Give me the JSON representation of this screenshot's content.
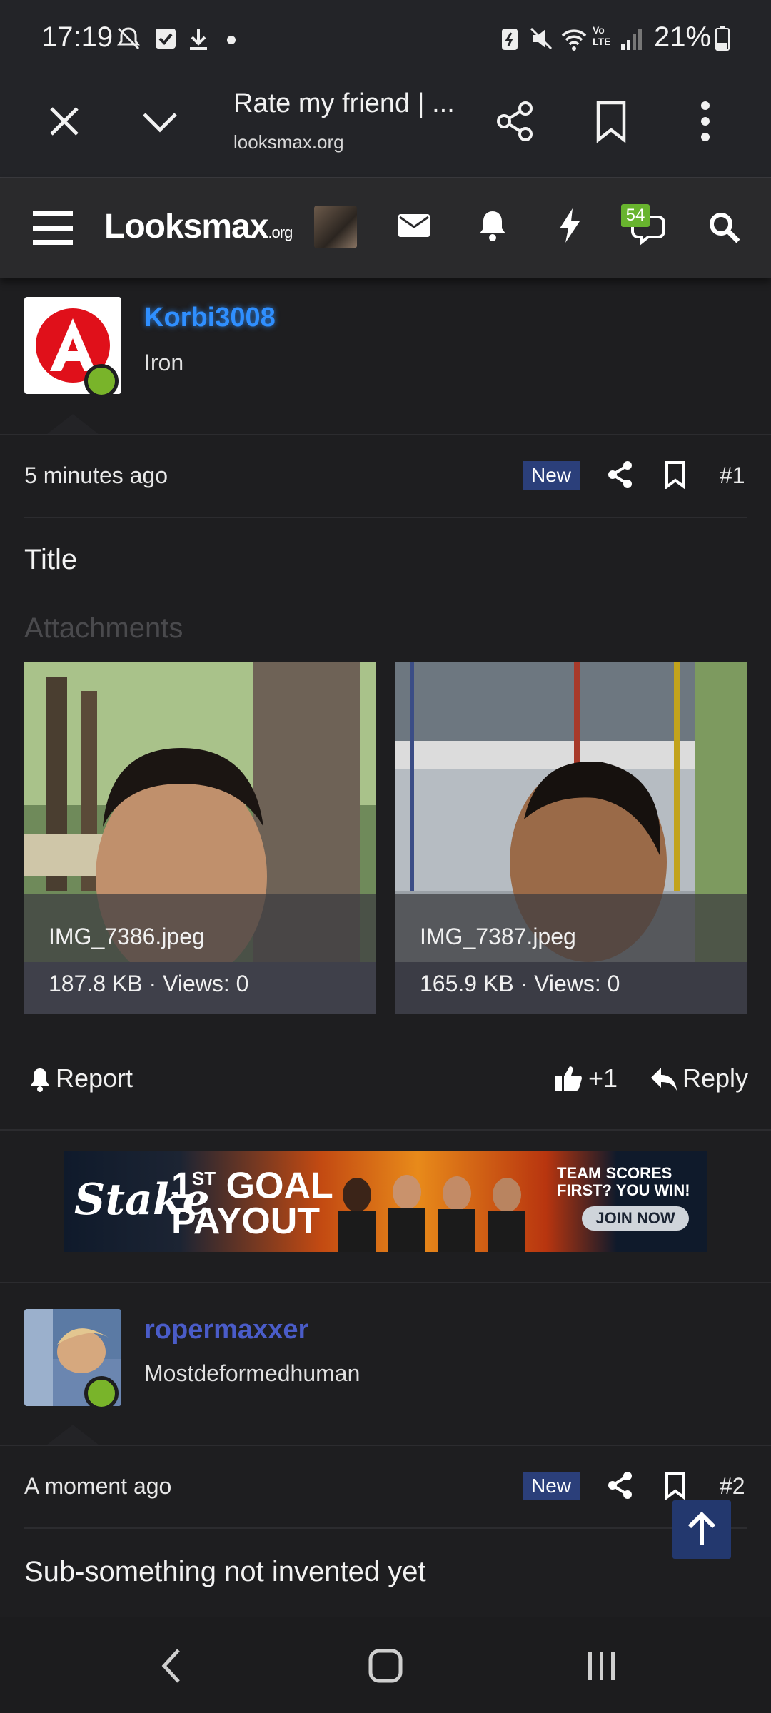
{
  "status_bar": {
    "time": "17:19",
    "battery": "21%",
    "icons": [
      "mute-notifications-icon",
      "checkbox-icon",
      "download-icon",
      "dot-icon",
      "battery-saver-icon",
      "mute-icon",
      "wifi-icon",
      "volte-icon",
      "signal-icon",
      "battery-icon"
    ]
  },
  "tab_bar": {
    "title": "Rate my friend | ...",
    "url": "looksmax.org"
  },
  "site_nav": {
    "logo": "Looksmax",
    "logo_suffix": ".org",
    "conversations_badge": "54"
  },
  "posts": [
    {
      "username": "Korbi3008",
      "username_color": "#2f8fff",
      "user_title": "Iron",
      "time": "5 minutes ago",
      "badge": "New",
      "number": "#1",
      "body": "Title",
      "attachments_label": "Attachments",
      "attachments": [
        {
          "name": "IMG_7386.jpeg",
          "meta": "187.8 KB · Views: 0"
        },
        {
          "name": "IMG_7387.jpeg",
          "meta": "165.9 KB · Views: 0"
        }
      ],
      "actions": {
        "report": "Report",
        "like": "+1",
        "reply": "Reply"
      }
    },
    {
      "username": "ropermaxxer",
      "username_color": "#4a5cc8",
      "user_title": "Mostdeformedhuman",
      "time": "A moment ago",
      "badge": "New",
      "number": "#2",
      "body": "Sub-something not invented yet"
    }
  ],
  "ad_banner": {
    "brand": "Stake",
    "headline_sup": "ST",
    "headline_1": "1",
    "headline_2": "GOAL",
    "headline_3": "PAYOUT",
    "tagline_1": "TEAM SCORES",
    "tagline_2": "FIRST? YOU WIN!",
    "cta": "JOIN NOW"
  },
  "colors": {
    "background": "#1e1e20",
    "accent_new_badge": "#2b3f7a",
    "online": "#79b42a",
    "badge_green": "#68b42e"
  }
}
